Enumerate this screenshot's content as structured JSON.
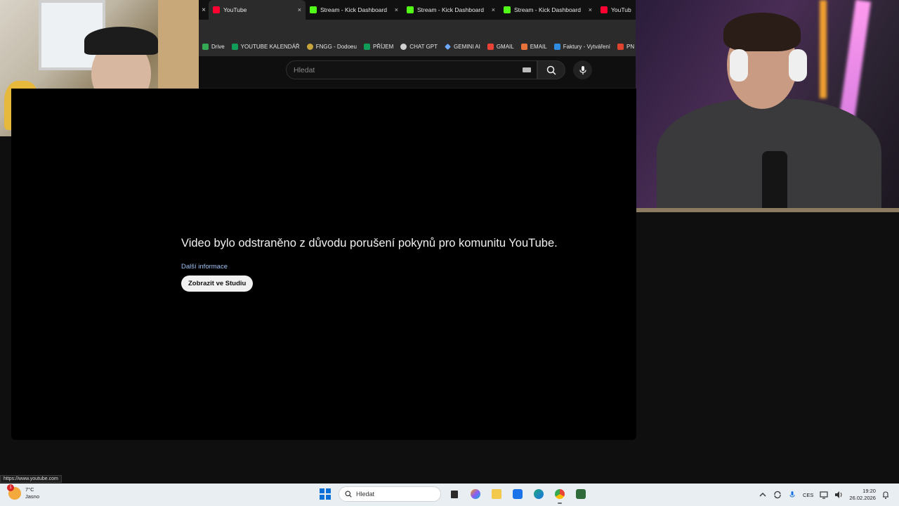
{
  "browser": {
    "tabs": [
      {
        "label": "YouTube",
        "favicon": "youtube-icon",
        "active": true
      },
      {
        "label": "Stream - Kick Dashboard",
        "favicon": "kick-icon",
        "active": false
      },
      {
        "label": "Stream - Kick Dashboard",
        "favicon": "kick-icon",
        "active": false
      },
      {
        "label": "Stream - Kick Dashboard",
        "favicon": "kick-icon",
        "active": false
      },
      {
        "label": "YouTub",
        "favicon": "youtube-icon",
        "active": false
      }
    ],
    "tab_close_glyph": "×",
    "bookmarks": [
      {
        "label": "Drive",
        "color": "#34a853"
      },
      {
        "label": "YOUTUBE KALENDÁŘ",
        "color": "#0f9d58"
      },
      {
        "label": "FNGG - Dodoeu",
        "color": "#c8a53a"
      },
      {
        "label": "PŘÍJEM",
        "color": "#0f9d58"
      },
      {
        "label": "CHAT GPT",
        "color": "#d0d0d0"
      },
      {
        "label": "GEMINI AI",
        "color": "#6ea8ff"
      },
      {
        "label": "GMAIL",
        "color": "#ea4335"
      },
      {
        "label": "EMAIL",
        "color": "#e8733a"
      },
      {
        "label": "Faktury - Vytváření",
        "color": "#2f8ae0"
      },
      {
        "label": "PN",
        "color": "#e0442f"
      }
    ]
  },
  "youtube": {
    "search_placeholder": "Hledat",
    "removed_message": "Video bylo odstraněno z důvodu porušení pokynů pro komunitu YouTube.",
    "more_info_link": "Další informace",
    "studio_button": "Zobrazit ve Studiu"
  },
  "status_url": "https://www.youtube.com",
  "taskbar": {
    "weather_temp": "7°C",
    "weather_desc": "Jasno",
    "weather_badge": "1",
    "search_label": "Hledat",
    "language": "CES",
    "time": "19:20",
    "date": "26.02.2026",
    "apps": [
      {
        "name": "file-explorer-icon",
        "color": "#2b2b2b"
      },
      {
        "name": "copilot-icon",
        "color": "#8b5cf6"
      },
      {
        "name": "folder-icon",
        "color": "#f2c94c"
      },
      {
        "name": "outlook-icon",
        "color": "#1a73e8"
      },
      {
        "name": "edge-icon",
        "color": "#1fa67a"
      },
      {
        "name": "chrome-icon",
        "color": "#ea4335"
      },
      {
        "name": "terminal-icon",
        "color": "#2f6b3a"
      }
    ]
  },
  "colors": {
    "youtube_red": "#ff0033",
    "kick_green": "#53fc18",
    "link_blue": "#9fc2f5",
    "windows_blue": "#0a6fd6"
  }
}
